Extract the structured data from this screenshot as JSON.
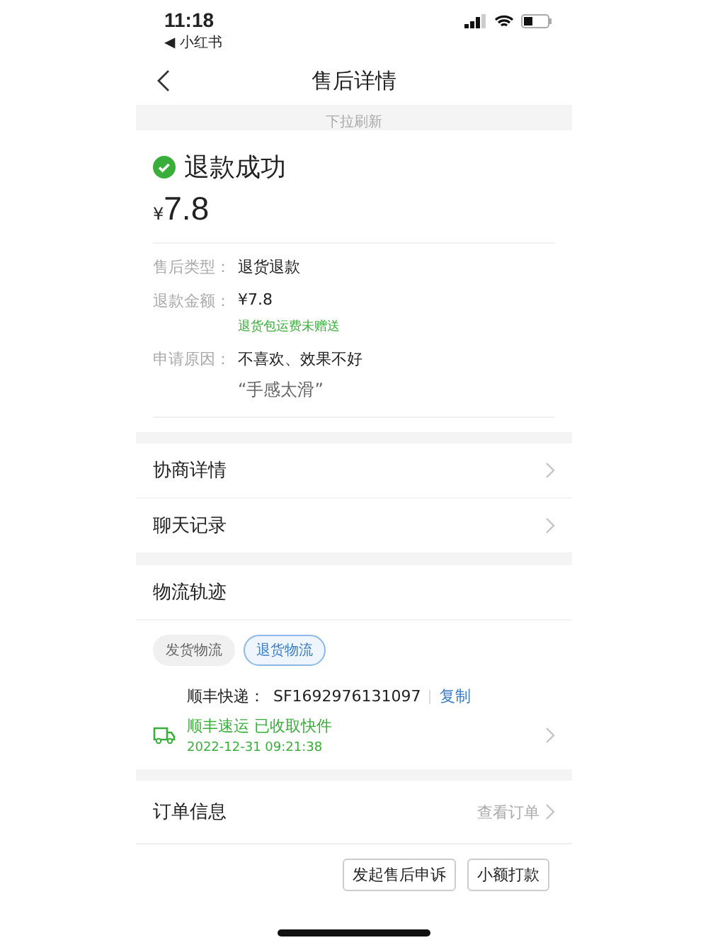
{
  "status_bar": {
    "time": "11:18",
    "back_app": "◀ 小红书"
  },
  "nav": {
    "title": "售后详情"
  },
  "pull_hint": "下拉刷新",
  "refund": {
    "status": "退款成功",
    "currency": "¥",
    "amount": "7.8"
  },
  "details": [
    {
      "label": "售后类型：",
      "value": "退货退款"
    },
    {
      "label": "退款金额：",
      "value": "¥7.8",
      "tag": "退货包运费未赠送"
    },
    {
      "label": "申请原因：",
      "value": "不喜欢、效果不好",
      "note": "“手感太滑”"
    }
  ],
  "links": [
    {
      "label": "协商详情"
    },
    {
      "label": "聊天记录"
    }
  ],
  "logistics": {
    "title": "物流轨迹",
    "tabs": [
      {
        "label": "发货物流",
        "selected": false
      },
      {
        "label": "退货物流",
        "selected": true
      }
    ],
    "carrier": "顺丰快递：",
    "tracking_no": "SF1692976131097",
    "copy": "复制",
    "event": "顺丰速运 已收取快件",
    "time": "2022-12-31 09:21:38"
  },
  "order": {
    "title": "订单信息",
    "action": "查看订单"
  },
  "buttons": [
    {
      "label": "发起售后申诉"
    },
    {
      "label": "小额打款"
    }
  ]
}
